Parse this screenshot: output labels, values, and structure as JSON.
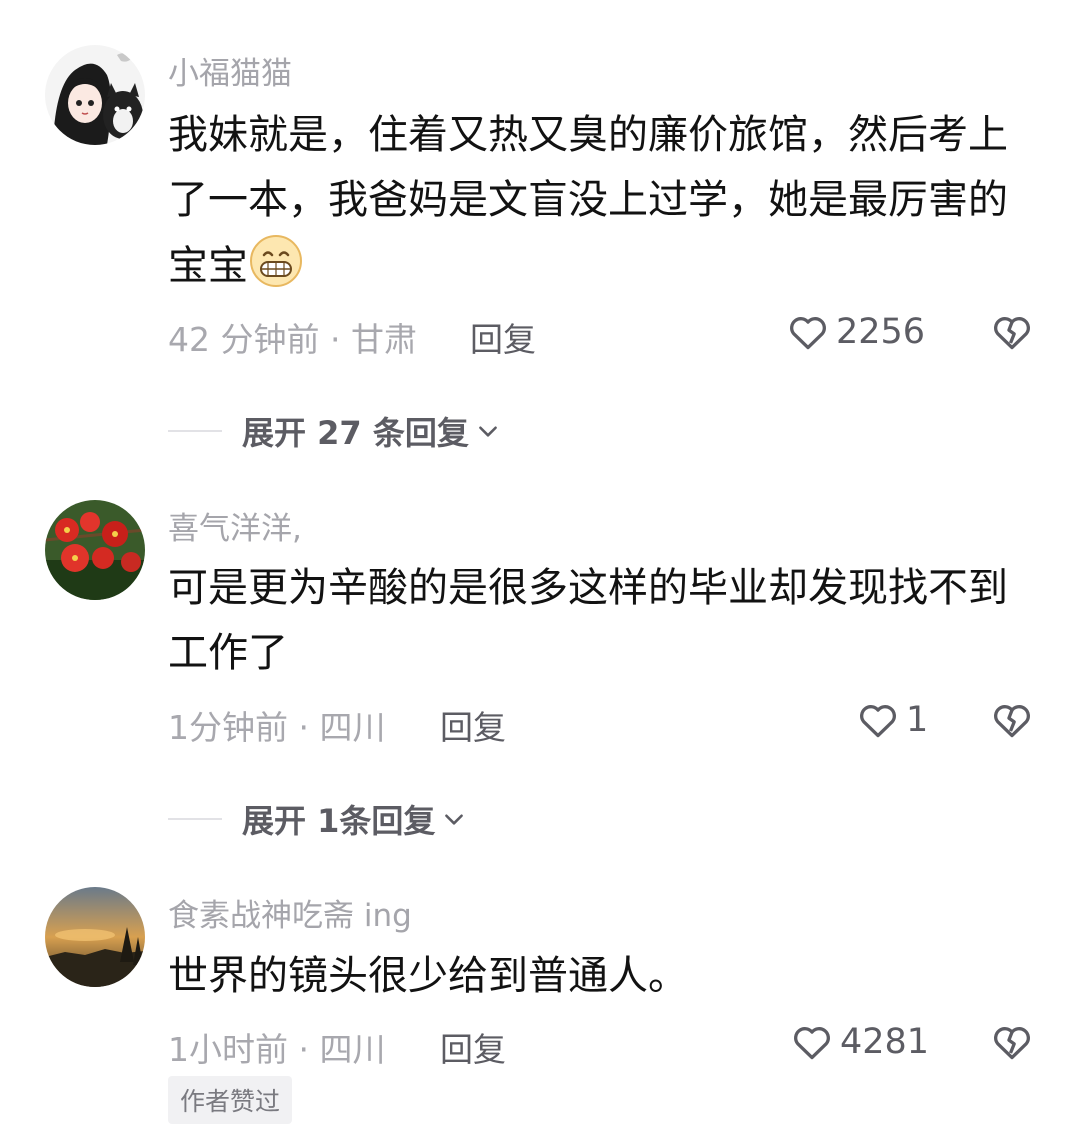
{
  "comments": [
    {
      "username": "小福猫猫",
      "text": "我妹就是，住着又热又臭的廉价旅馆，然后考上了一本，我爸妈是文盲没上过学，她是最厉害的宝宝",
      "emoji": "grinning-face-emoji",
      "meta": "42 分钟前 · 甘肃",
      "reply_label": "回复",
      "like_count": "2256",
      "expand_label": "展开 27 条回复"
    },
    {
      "username": "喜气洋洋,",
      "text": "可是更为辛酸的是很多这样的毕业却发现找不到工作了",
      "meta": "1分钟前 · 四川",
      "reply_label": "回复",
      "like_count": "1",
      "expand_label": "展开 1条回复"
    },
    {
      "username": "食素战神吃斋 ing",
      "text": "世界的镜头很少给到普通人。",
      "meta": "1小时前 · 四川",
      "reply_label": "回复",
      "like_count": "4281",
      "badge": "作者赞过"
    }
  ],
  "icons": {
    "like": "heart-outline-icon",
    "dislike": "broken-heart-icon",
    "expand": "chevron-down-icon"
  },
  "colors": {
    "text": "#121212",
    "muted": "#a8a8ae",
    "secondary": "#5c5c63"
  }
}
